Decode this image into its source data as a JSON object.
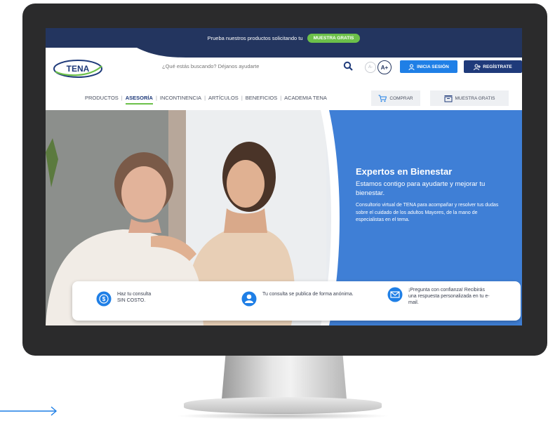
{
  "promo": {
    "text": "Prueba nuestros productos solicitando tu",
    "button": "MUESTRA GRATIS"
  },
  "header": {
    "logo_text": "TENA",
    "search_placeholder": "¿Qué estás buscando? Déjanos ayudarte",
    "font_small": "A-",
    "font_big": "A+",
    "login_label": "INICIA SESIÓN",
    "register_label": "REGÍSTRATE"
  },
  "nav": {
    "items": [
      "PRODUCTOS",
      "ASESORÍA",
      "INCONTINENCIA",
      "ARTÍCULOS",
      "BENEFICIOS",
      "ACADEMIA TENA"
    ],
    "active": "ASESORÍA",
    "shop_label": "COMPRAR",
    "sample_label": "MUESTRA GRATIS"
  },
  "hero": {
    "title": "Expertos en Bienestar",
    "subtitle": "Estamos contigo para ayudarte y mejorar tu bienestar.",
    "body": "Consultorio virtual de TENA para acompañar y resolver tus dudas sobre el cuidado de los adultos Mayores, de la mano de especialistas en el tema."
  },
  "features": [
    {
      "icon": "dollar-icon",
      "text": "Haz tu consulta\nSIN COSTO."
    },
    {
      "icon": "user-icon",
      "text": "Tu consulta se publica de forma anónima."
    },
    {
      "icon": "mail-icon",
      "text": "¡Pregunta con confianza! Recibirás una respuesta personalizada en tu e-mail."
    }
  ],
  "colors": {
    "navy": "#23355f",
    "green": "#6cc04a",
    "blue": "#1f7fe6",
    "hero_blue": "#3f7fd6"
  }
}
